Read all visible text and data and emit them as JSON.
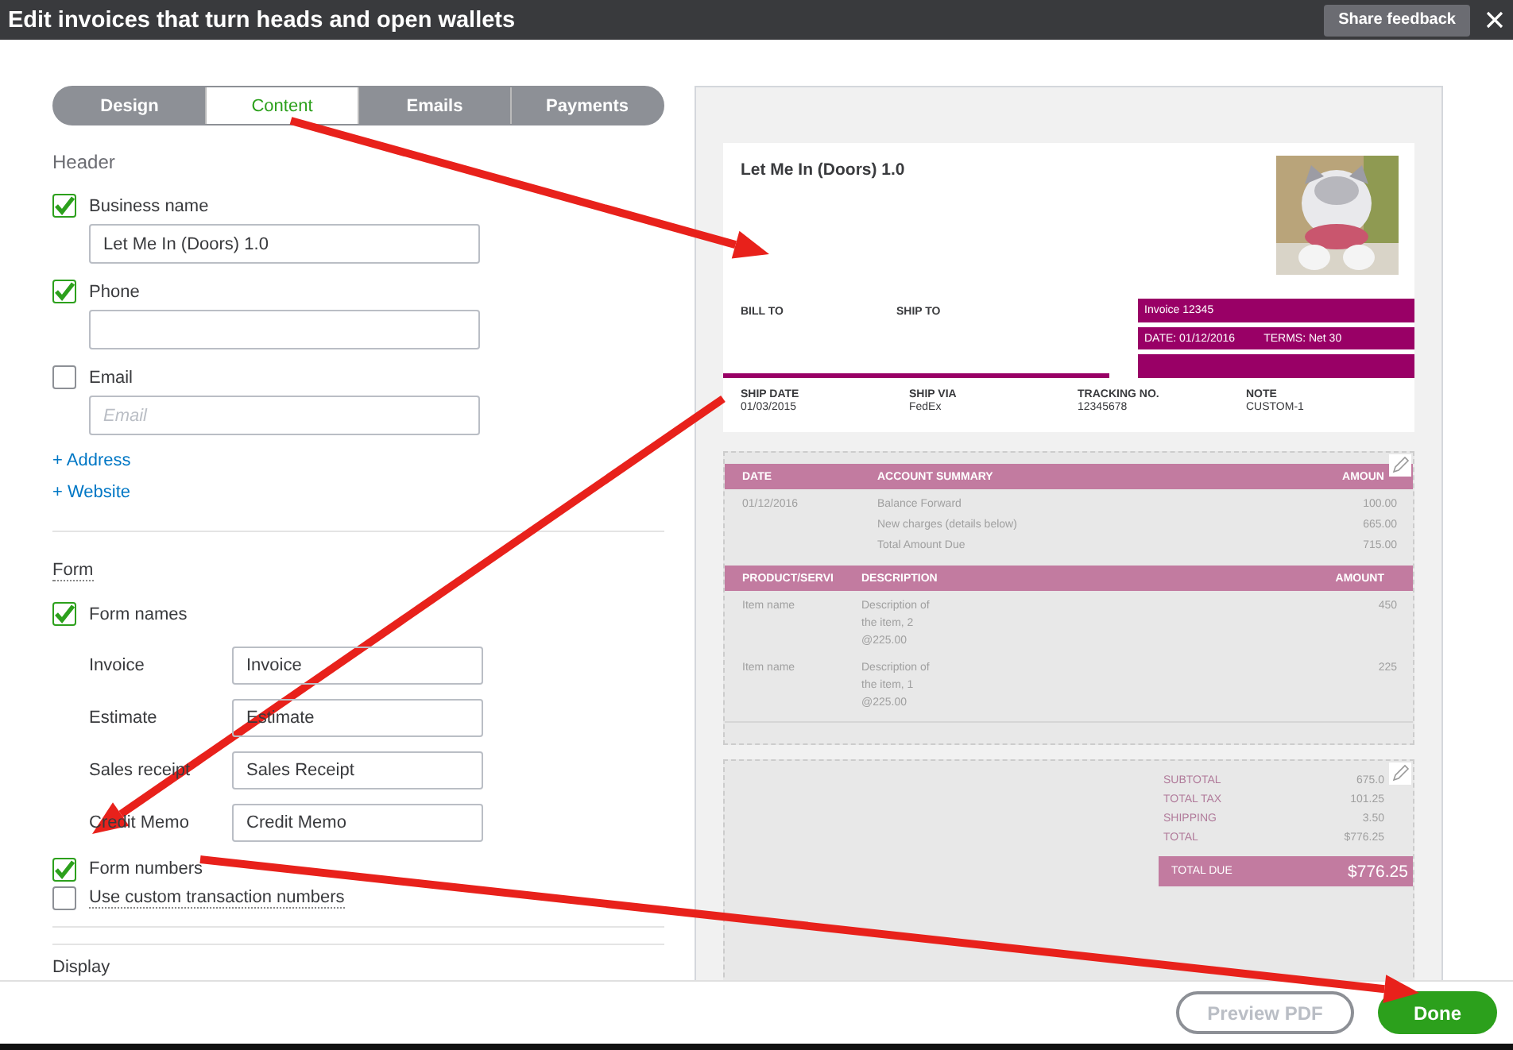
{
  "window": {
    "title": "Edit invoices that turn heads and open wallets",
    "feedback_button": "Share feedback"
  },
  "tabs": [
    {
      "label": "Design",
      "selected": false
    },
    {
      "label": "Content",
      "selected": true
    },
    {
      "label": "Emails",
      "selected": false
    },
    {
      "label": "Payments",
      "selected": false
    }
  ],
  "header_section": {
    "title": "Header",
    "fields": [
      {
        "label": "Business name",
        "checked": true,
        "value": "Let Me In (Doors) 1.0"
      },
      {
        "label": "Phone",
        "checked": true
      },
      {
        "label": "Email",
        "checked": false,
        "placeholder": "Email"
      }
    ],
    "links": [
      "+ Address",
      "+ Website"
    ]
  },
  "form_section": {
    "title": "Form",
    "form_names": {
      "label": "Form names",
      "checked": true,
      "names": [
        {
          "label": "Invoice",
          "value": "Invoice"
        },
        {
          "label": "Estimate",
          "value": "Estimate"
        },
        {
          "label": "Sales receipt",
          "value": "Sales Receipt"
        },
        {
          "label": "Credit Memo",
          "value": "Credit Memo"
        }
      ]
    },
    "options": [
      {
        "label": "Form numbers",
        "checked": true,
        "kind": "plain"
      },
      {
        "label": "Use custom transaction numbers",
        "checked": false,
        "kind": "dotted"
      }
    ]
  },
  "display_section": {
    "title": "Display"
  },
  "preview": {
    "company": "Let Me In (Doors) 1.0",
    "bill_to": "BILL TO",
    "ship_to": "SHIP TO",
    "invoice_no": "Invoice 12345",
    "date": "DATE: 01/12/2016",
    "terms": "TERMS: Net 30",
    "shipping": [
      {
        "label": "SHIP DATE",
        "value": "01/03/2015"
      },
      {
        "label": "SHIP VIA",
        "value": "FedEx"
      },
      {
        "label": "TRACKING NO.",
        "value": "12345678"
      },
      {
        "label": "NOTE",
        "value": "CUSTOM-1"
      }
    ],
    "account_summary": {
      "columns": [
        "DATE",
        "ACCOUNT SUMMARY",
        "AMOUN"
      ],
      "date": "01/12/2016",
      "rows": [
        {
          "label": "Balance Forward",
          "amount": "100.00"
        },
        {
          "label": "New charges (details below)",
          "amount": "665.00"
        },
        {
          "label": "Total Amount Due",
          "amount": "715.00"
        }
      ]
    },
    "products": {
      "columns": [
        "PRODUCT/SERVI",
        "DESCRIPTION",
        "AMOUNT"
      ],
      "rows": [
        {
          "name": "Item name",
          "description": "Description of the item, 2 @225.00",
          "amount": "450"
        },
        {
          "name": "Item name",
          "description": "Description of the item, 1 @225.00",
          "amount": "225"
        }
      ]
    },
    "totals": [
      {
        "label": "SUBTOTAL",
        "value": "675.0"
      },
      {
        "label": "TOTAL TAX",
        "value": "101.25"
      },
      {
        "label": "SHIPPING",
        "value": "3.50"
      },
      {
        "label": "TOTAL",
        "value": "$776.25"
      }
    ],
    "total_due": {
      "label": "TOTAL DUE",
      "value": "$776.25"
    }
  },
  "footer": {
    "preview_button": "Preview PDF",
    "done_button": "Done"
  },
  "annotations": [
    {
      "kind": "arrow"
    },
    {
      "kind": "arrow"
    },
    {
      "kind": "arrow"
    }
  ]
}
